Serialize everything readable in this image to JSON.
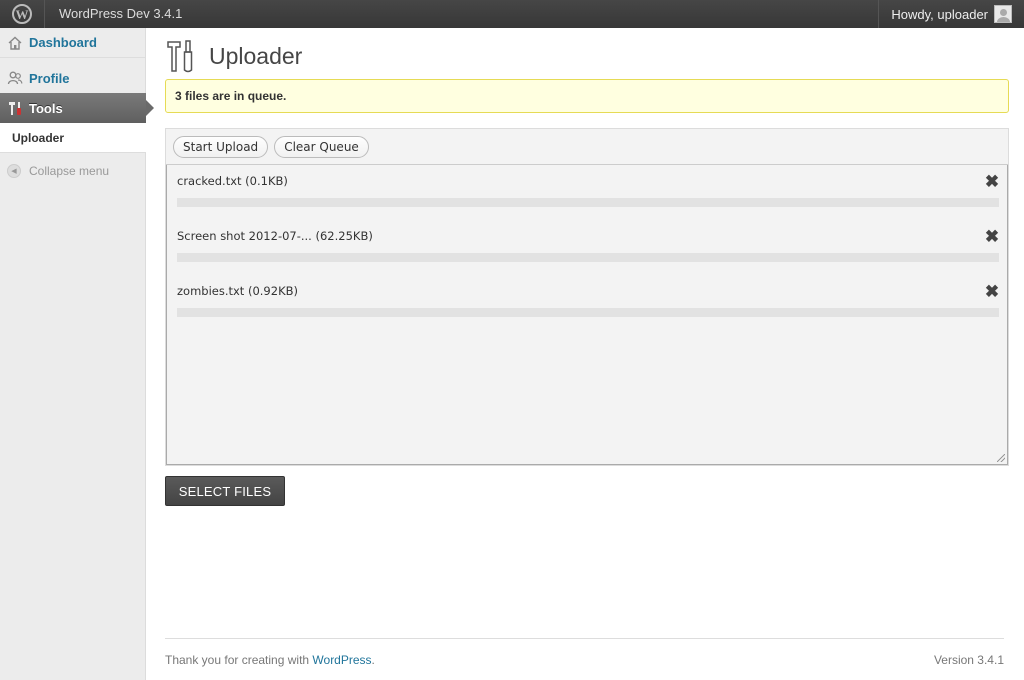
{
  "adminbar": {
    "logo_glyph": "W",
    "site_name": "WordPress Dev 3.4.1",
    "howdy": "Howdy, uploader"
  },
  "sidebar": {
    "items": [
      {
        "label": "Dashboard",
        "icon": "home-icon"
      },
      {
        "label": "Profile",
        "icon": "users-icon"
      },
      {
        "label": "Tools",
        "icon": "tools-icon"
      }
    ],
    "submenu": [
      {
        "label": "Uploader"
      }
    ],
    "collapse_label": "Collapse menu"
  },
  "page": {
    "title": "Uploader",
    "notice": "3 files are in queue."
  },
  "uploader": {
    "start_label": "Start Upload",
    "clear_label": "Clear Queue",
    "select_label": "SELECT FILES",
    "files": [
      {
        "name": "cracked.txt (0.1KB)",
        "progress": 0
      },
      {
        "name": "Screen shot 2012-07-... (62.25KB)",
        "progress": 0
      },
      {
        "name": "zombies.txt (0.92KB)",
        "progress": 0
      }
    ],
    "remove_glyph": "✖"
  },
  "footer": {
    "thanks_prefix": "Thank you for creating with ",
    "thanks_link": "WordPress",
    "thanks_suffix": ".",
    "version": "Version 3.4.1"
  },
  "colors": {
    "link": "#21759b",
    "notice_bg": "#ffffe0",
    "notice_border": "#e6db55",
    "adminbar_bg": "#464646"
  }
}
